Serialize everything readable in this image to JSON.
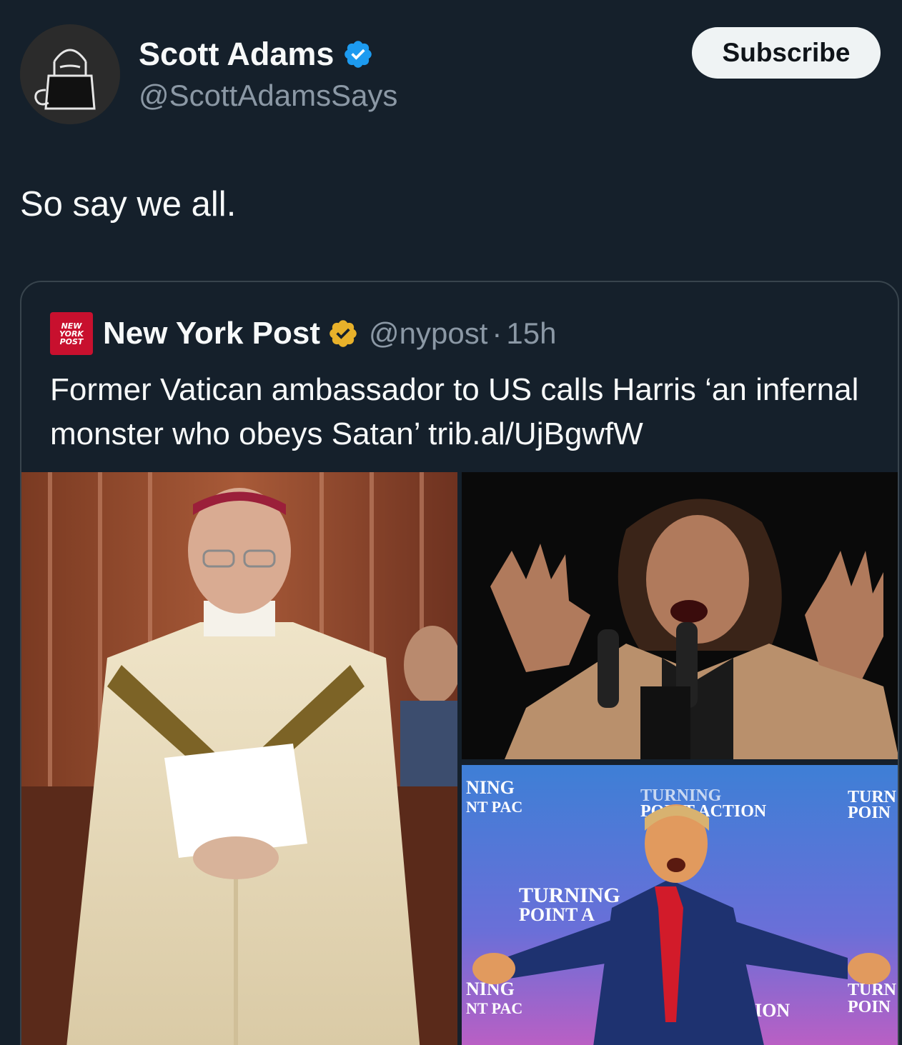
{
  "author": {
    "name": "Scott Adams",
    "handle": "@ScottAdamsSays",
    "verified_color": "#1d9bf0"
  },
  "actions": {
    "subscribe_label": "Subscribe"
  },
  "tweet": {
    "text": "So say we all."
  },
  "quote": {
    "logo_lines": [
      "NEW",
      "YORK",
      "POST"
    ],
    "name": "New York Post",
    "badge_color": "#e8b12a",
    "handle": "@nypost",
    "separator": "·",
    "time": "15h",
    "text": "Former Vatican ambassador to US calls Harris ‘an infernal monster who obeys Satan’ trib.al/UjBgwfW",
    "images": [
      {
        "description_icon": "photo-icon"
      },
      {
        "description_icon": "photo-icon"
      },
      {
        "description_icon": "photo-icon"
      }
    ],
    "sign_texts": {
      "a": "NING",
      "b": "NT PAC",
      "c": "TURNING",
      "d": "POINT ACTION",
      "e": "TURN",
      "f": "POIN",
      "g": "TURNING",
      "h": "POINT A",
      "i": "NING",
      "j": "NT PAC",
      "k": "ION"
    }
  }
}
